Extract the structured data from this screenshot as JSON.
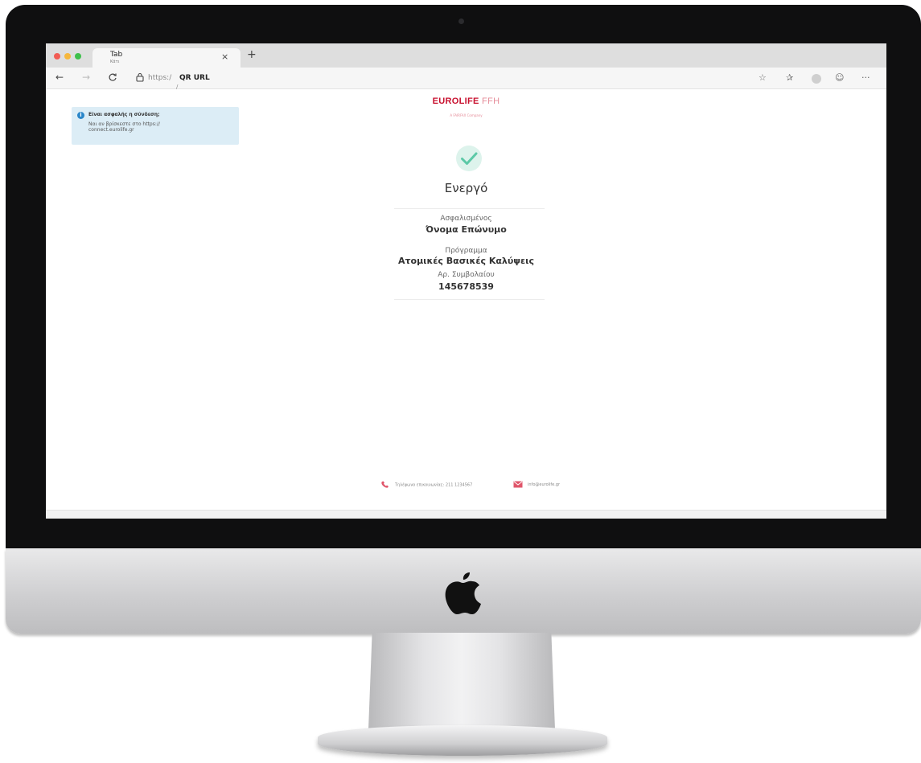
{
  "browser": {
    "tab_title": "Tab",
    "tab_subtitle": "Κάτι",
    "tab_close": "×",
    "new_tab": "+",
    "url_scheme": "https:/",
    "url_host": "QR URL",
    "url_slash": "/"
  },
  "security_notice": {
    "title": "Είναι ασφαλής η σύνδεση;",
    "body": "Ναι αν βρίσκεστε στο https:// connect.eurolife.gr"
  },
  "brand": {
    "logo_main": "EUROLIFE",
    "logo_secondary": "FFH",
    "tagline": "A FAIRFAX Company",
    "color": "#c8102e"
  },
  "status": {
    "label": "Ενεργό",
    "icon": "check-circle-icon",
    "color": "#5cc9a7"
  },
  "fields": {
    "insured_label": "Ασφαλισμένος",
    "insured_value": "Όνομα Επώνυμο",
    "program_label": "Πρόγραμμα",
    "program_value": "Ατομικές Βασικές Καλύψεις",
    "contract_label": "Αρ. Συμβολαίου",
    "contract_value": "145678539"
  },
  "footer": {
    "phone_text": "Τηλέφωνο επικοινωνίας: 211 1234567",
    "email_text": "info@eurolife.gr"
  }
}
